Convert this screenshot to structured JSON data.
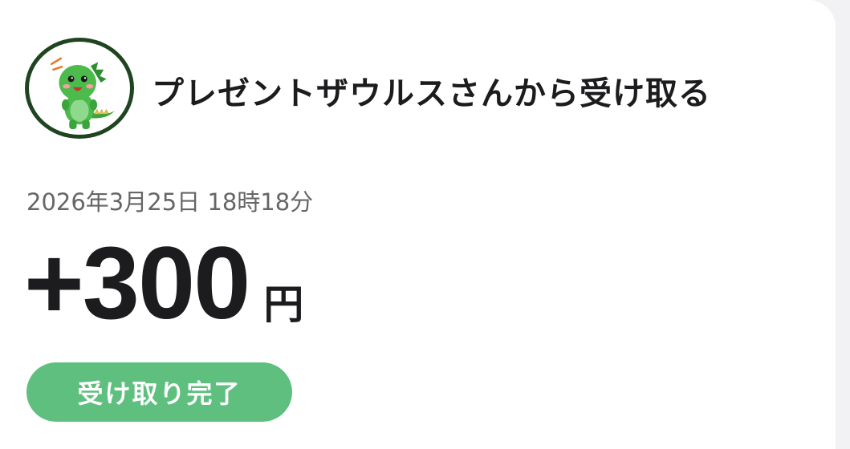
{
  "sender": {
    "title": "プレゼントザウルスさんから受け取る",
    "avatar_icon": "dinosaur-mascot-icon"
  },
  "transaction": {
    "datetime": "2026年3月25日 18時18分",
    "amount": "+300",
    "currency_unit": "円"
  },
  "status": {
    "label": "受け取り完了"
  },
  "colors": {
    "avatar_border": "#1f4420",
    "badge_background": "#5fbf7f",
    "primary_text": "#1c1c1e",
    "secondary_text": "#666666"
  }
}
